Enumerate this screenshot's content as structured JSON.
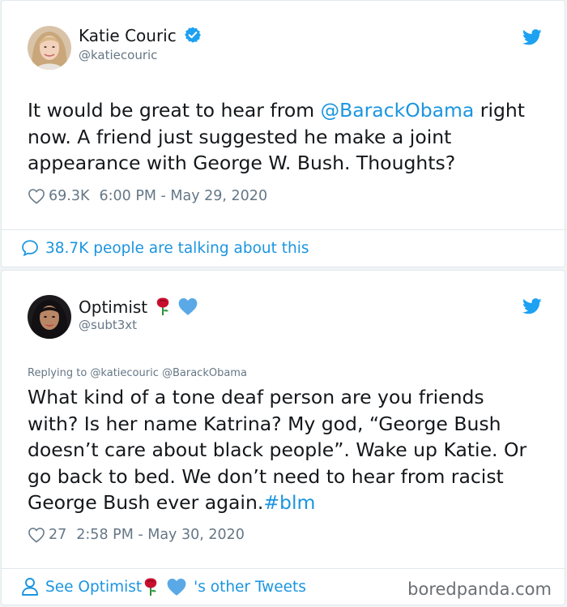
{
  "tweet1": {
    "author_name": "Katie Couric",
    "author_handle": "@katiecouric",
    "text_before": "It would be great to hear from ",
    "mention": "@BarackObama",
    "text_after": " right\nnow. A friend just suggested he make a joint\nappearance with George W. Bush. Thoughts?",
    "likes": "69.3K",
    "timestamp": "6:00 PM - May 29, 2020",
    "footer_text": "38.7K people are talking about this"
  },
  "tweet2": {
    "author_name": "Optimist",
    "author_handle": "@subt3xt",
    "replying_to": "Replying to @katiecouric @BarackObama",
    "text": "What kind of a tone deaf person are you friends\nwith? Is her name Katrina? My god, “George Bush\ndoesn’t care about black people”. Wake up Katie. Or\ngo back to bed. We don’t need to hear from racist\nGeorge Bush ever again.",
    "hashtag": "#blm",
    "likes": "27",
    "timestamp": "2:58 PM - May 30, 2020",
    "footer_prefix": "See Optimist",
    "footer_suffix": "'s other Tweets"
  },
  "watermark": "boredpanda.com",
  "colors": {
    "link": "#1b95e0",
    "muted": "#657786",
    "verified": "#1da1f2",
    "heart_emoji": "#5aa9e6",
    "rose": "#c8102e"
  },
  "icons": [
    "verified-badge-icon",
    "twitter-bird-icon",
    "heart-icon",
    "speech-bubble-icon",
    "person-icon",
    "rose-emoji",
    "blue-heart-emoji"
  ]
}
